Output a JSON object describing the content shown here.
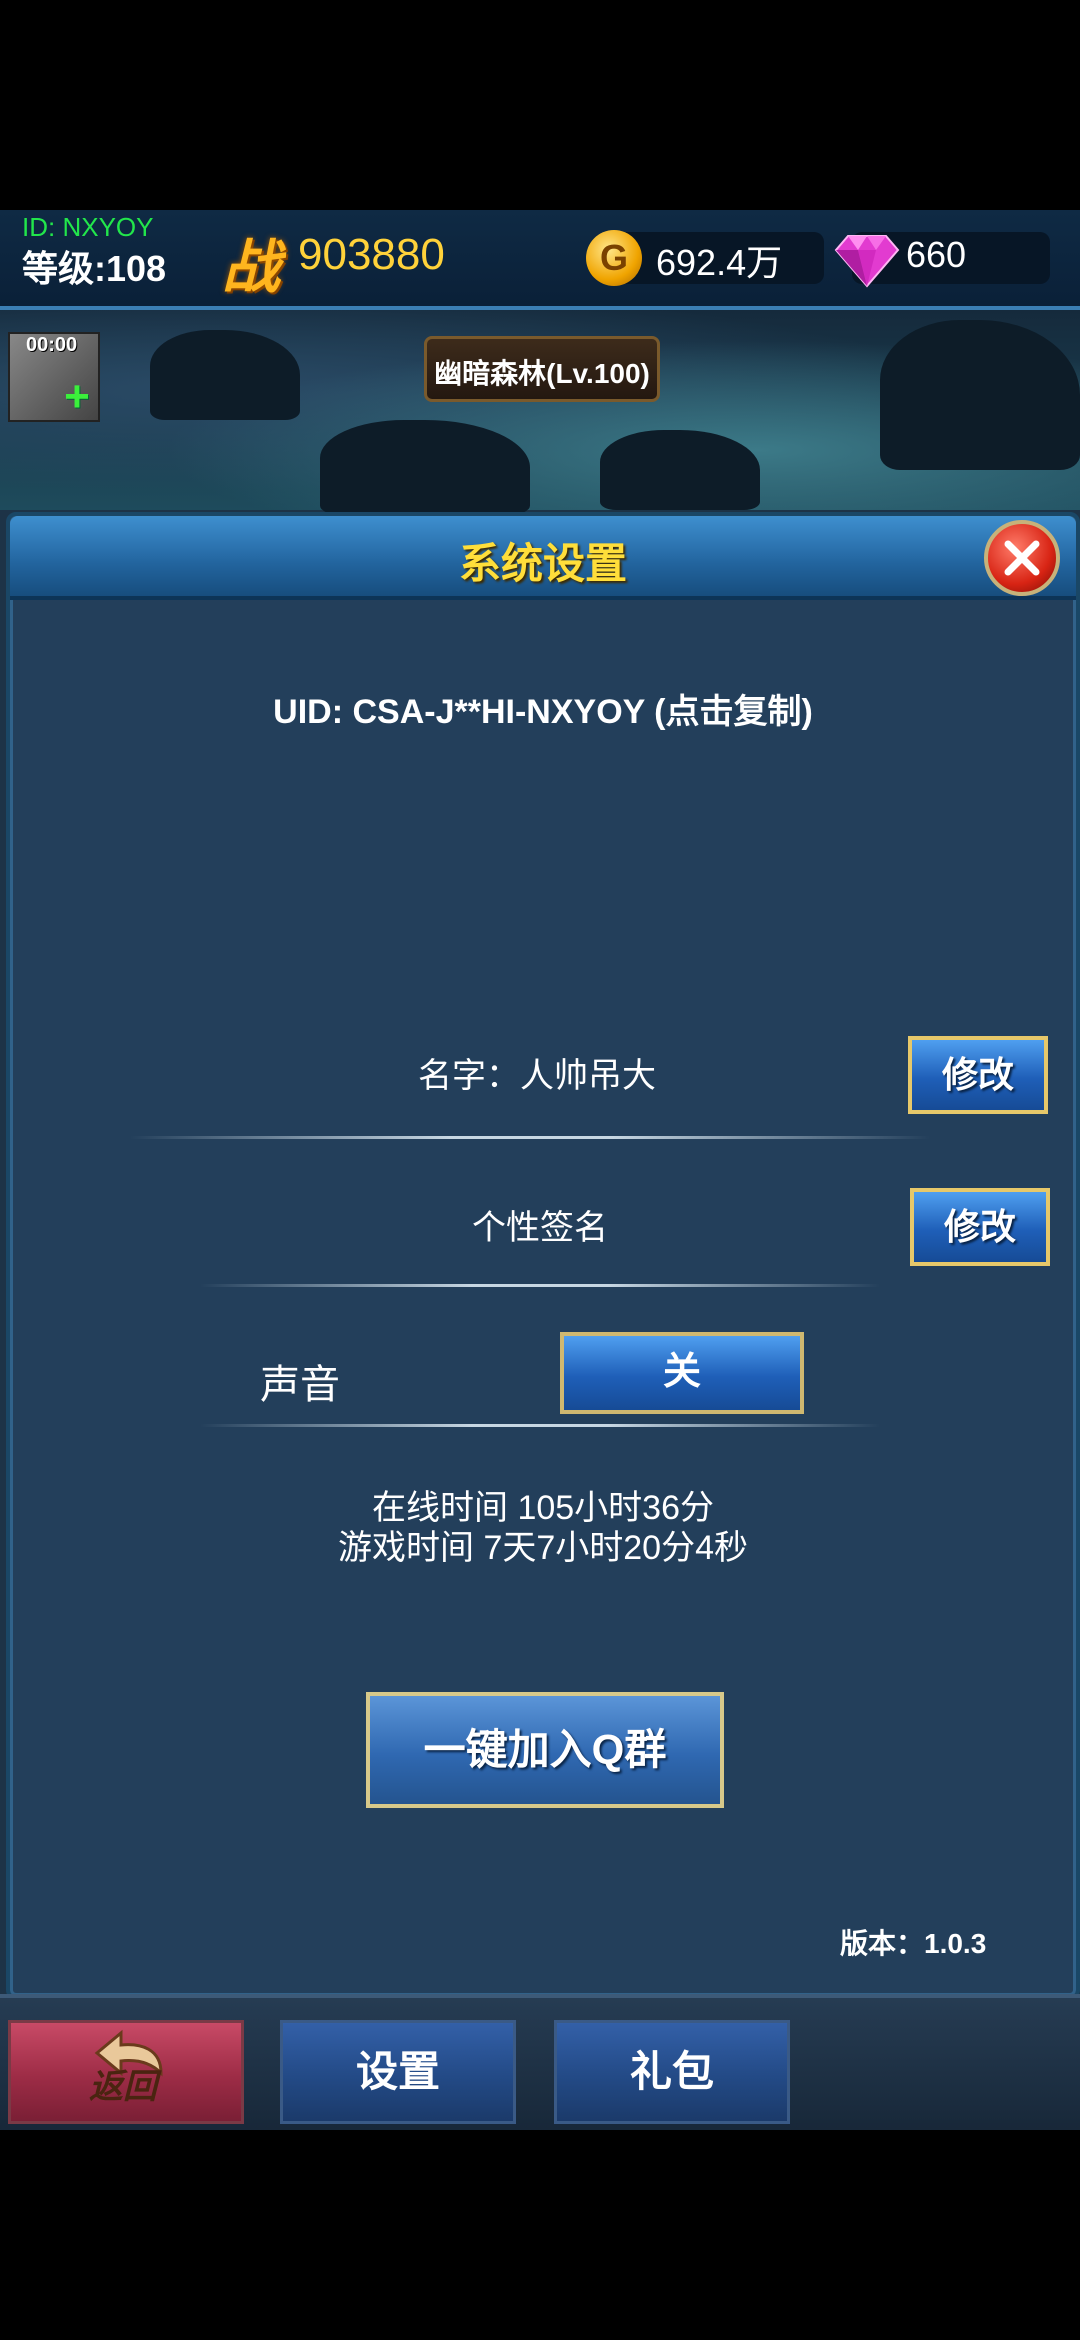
{
  "status_bar": {
    "player_id": "ID: NXYOY",
    "level": "等级:108",
    "power_label": "战",
    "power_value": "903880",
    "gold_icon_letter": "G",
    "gold_value": "692.4万",
    "gem_value": "660"
  },
  "scene": {
    "timer": "00:00",
    "location": "幽暗森林(Lv.100)"
  },
  "dialog": {
    "title": "系统设置",
    "uid": "UID: CSA-J**HI-NXYOY (点击复制)",
    "name_label": "名字：人帅吊大",
    "name_edit": "修改",
    "signature_label": "个性签名",
    "signature_edit": "修改",
    "sound_label": "声音",
    "sound_toggle": "关",
    "online_time": "在线时间 105小时36分",
    "game_time": "游戏时间 7天7小时20分4秒",
    "join_group": "一键加入Q群",
    "version": "版本：1.0.3"
  },
  "bottom_nav": {
    "back": "返回",
    "settings": "设置",
    "gift": "礼包"
  },
  "colors": {
    "title_yellow": "#ffde3a",
    "id_green": "#22e64b",
    "power_gold": "#ffd23a",
    "panel_bg": "#233f5b",
    "button_blue": "#1f5fb8",
    "back_red": "#9d2c46"
  },
  "icons": [
    "gold-coin-icon",
    "gem-icon",
    "close-icon",
    "back-arrow-icon",
    "map-add-icon"
  ]
}
